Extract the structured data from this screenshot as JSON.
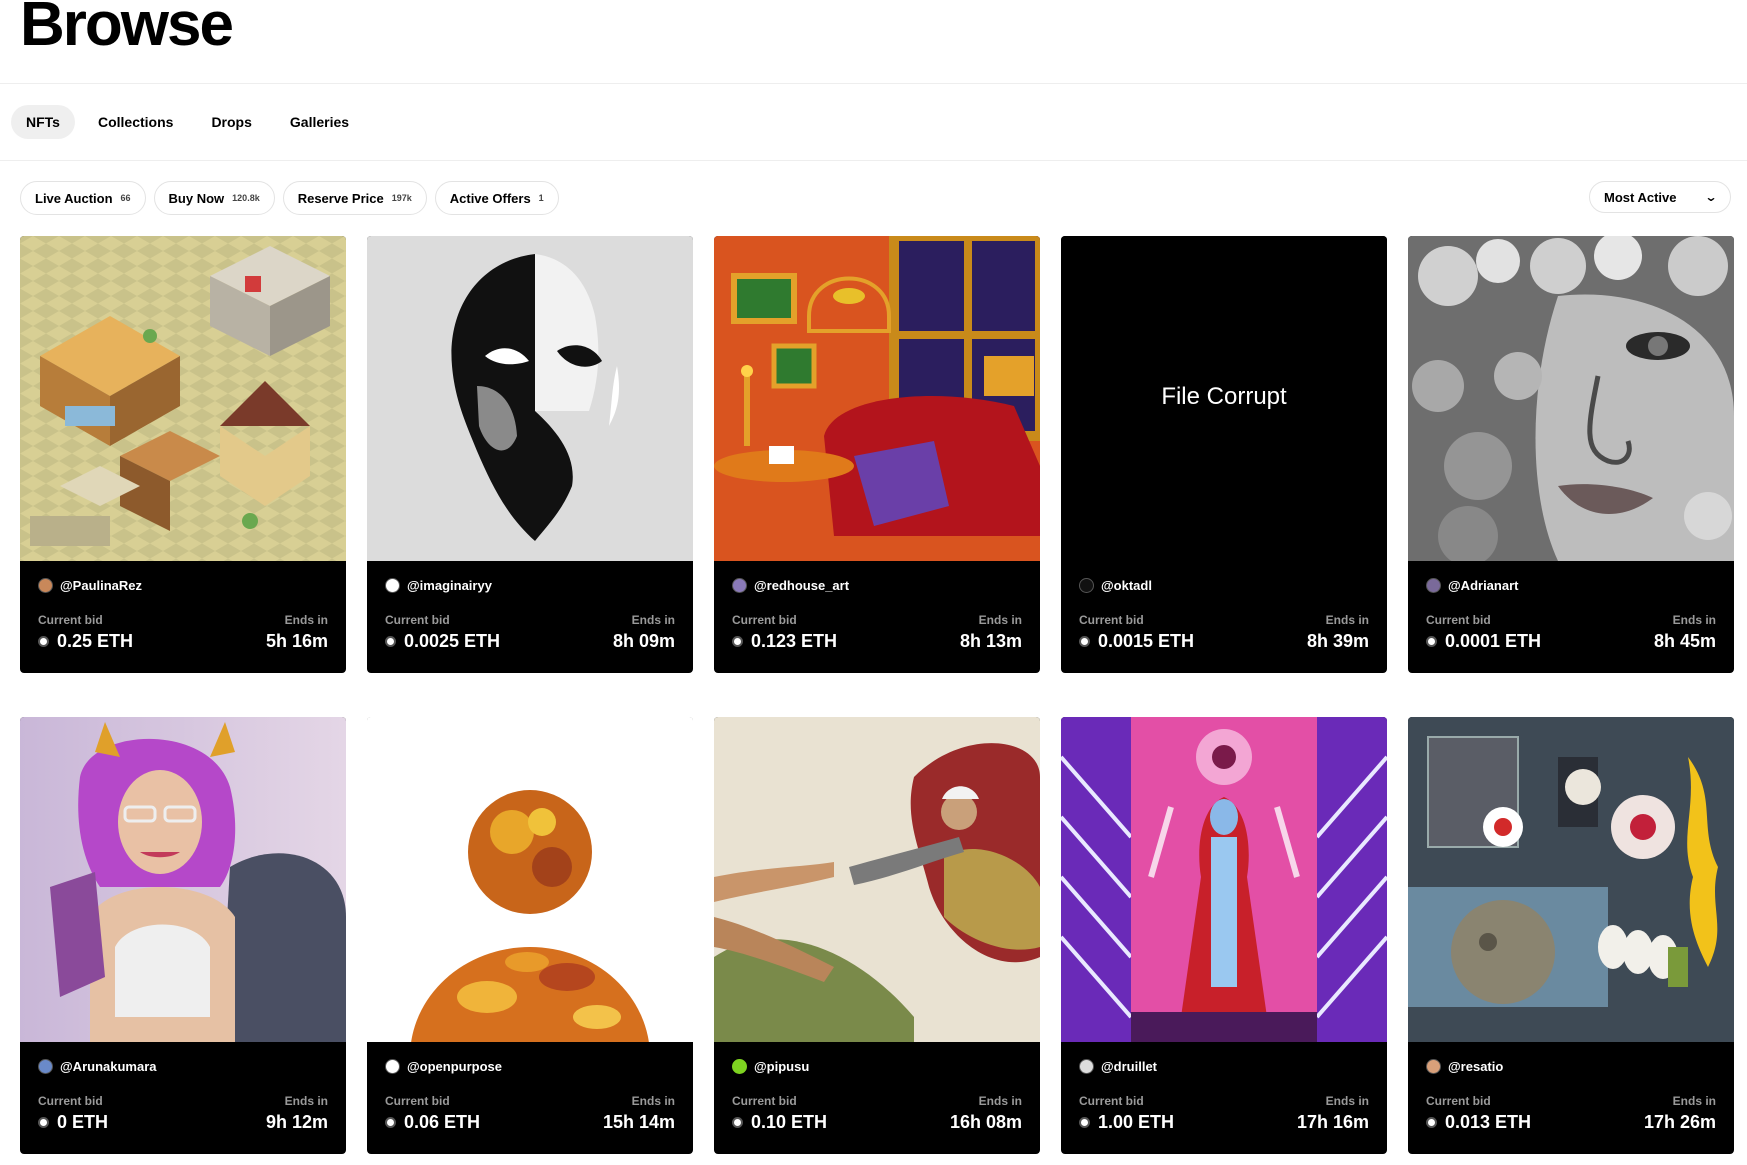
{
  "page": {
    "title": "Browse"
  },
  "tabs": [
    {
      "label": "NFTs",
      "active": true
    },
    {
      "label": "Collections"
    },
    {
      "label": "Drops"
    },
    {
      "label": "Galleries"
    }
  ],
  "filters": [
    {
      "label": "Live Auction",
      "count": "66"
    },
    {
      "label": "Buy Now",
      "count": "120.8k"
    },
    {
      "label": "Reserve Price",
      "count": "197k"
    },
    {
      "label": "Active Offers",
      "count": "1"
    }
  ],
  "sort": {
    "label": "Most Active"
  },
  "labels": {
    "current_bid": "Current bid",
    "ends_in": "Ends in"
  },
  "cards": [
    {
      "creator": "@PaulinaRez",
      "bid": "0.25 ETH",
      "ends": "5h 16m"
    },
    {
      "creator": "@imaginairyy",
      "bid": "0.0025 ETH",
      "ends": "8h 09m"
    },
    {
      "creator": "@redhouse_art",
      "bid": "0.123 ETH",
      "ends": "8h 13m"
    },
    {
      "creator": "@oktadl",
      "bid": "0.0015 ETH",
      "ends": "8h 39m",
      "art_text": "File Corrupt"
    },
    {
      "creator": "@Adrianart",
      "bid": "0.0001 ETH",
      "ends": "8h 45m"
    },
    {
      "creator": "@Arunakumara",
      "bid": "0 ETH",
      "ends": "9h 12m"
    },
    {
      "creator": "@openpurpose",
      "bid": "0.06 ETH",
      "ends": "15h 14m"
    },
    {
      "creator": "@pipusu",
      "bid": "0.10 ETH",
      "ends": "16h 08m"
    },
    {
      "creator": "@druillet",
      "bid": "1.00 ETH",
      "ends": "17h 16m"
    },
    {
      "creator": "@resatio",
      "bid": "0.013 ETH",
      "ends": "17h 26m"
    }
  ],
  "colors": {
    "card_bg": "#000000",
    "muted_text": "#9a9a9a",
    "active_tab_bg": "#efefef"
  }
}
